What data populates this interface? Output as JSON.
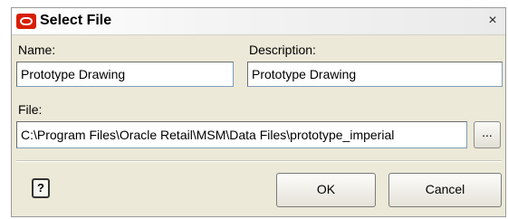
{
  "window": {
    "title": "Select File",
    "close_label": "×"
  },
  "form": {
    "name_label": "Name:",
    "name_value": "Prototype Drawing",
    "description_label": "Description:",
    "description_value": "Prototype Drawing",
    "file_label": "File:",
    "file_value": "C:\\Program Files\\Oracle Retail\\MSM\\Data Files\\prototype_imperial",
    "browse_label": "..."
  },
  "footer": {
    "help_label": "?",
    "ok_label": "OK",
    "cancel_label": "Cancel"
  },
  "icons": {
    "logo": "oracle-logo-icon",
    "help": "help-icon"
  },
  "colors": {
    "logo": "#d81e05",
    "dialog_background": "#ece9d8"
  }
}
